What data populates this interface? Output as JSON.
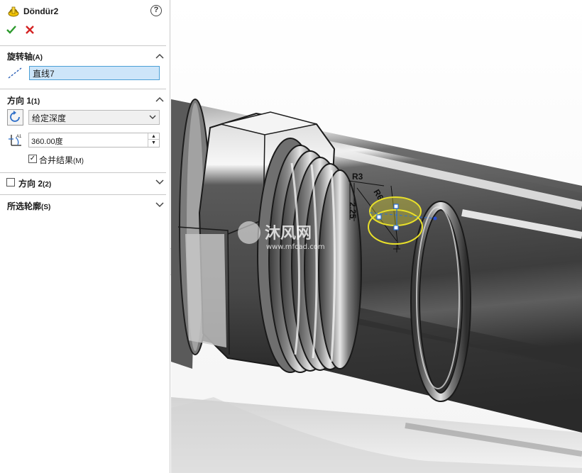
{
  "feature": {
    "title": "Döndür2",
    "help_label": "?"
  },
  "axis_section": {
    "title": "旋转轴",
    "shortcut": "(A)",
    "axis_value": "直线7"
  },
  "direction1": {
    "title": "方向 1",
    "shortcut": "(1)",
    "end_condition": "给定深度",
    "angle_value": "360.00度",
    "merge_label": "合并结果",
    "merge_shortcut": "(M)",
    "merge_checked": "✓"
  },
  "direction2": {
    "title": "方向 2",
    "shortcut": "(2)"
  },
  "contours": {
    "title": "所选轮廓",
    "shortcut": "(S)"
  },
  "sketch_dims": {
    "radius_a": "R3",
    "radius_b": "R6",
    "length": "2.25"
  },
  "watermark": {
    "brand": "沐风网",
    "url": "www.mfcad.com"
  },
  "colors": {
    "accept": "#2d9a2d",
    "cancel": "#d42323",
    "selection": "#cde5f9",
    "highlight": "#e8e02a"
  }
}
